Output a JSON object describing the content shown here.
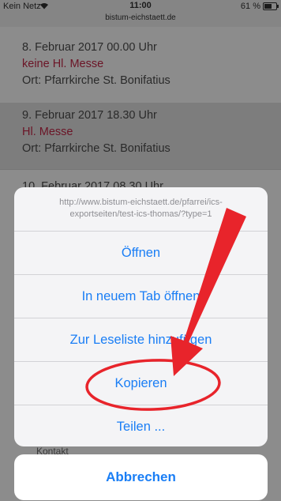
{
  "status_bar": {
    "carrier": "Kein Netz",
    "time": "11:00",
    "url": "bistum-eichstaett.de",
    "battery": "61 %"
  },
  "events": [
    {
      "date": "8. Februar 2017 00.00 Uhr",
      "title": "keine Hl. Messe",
      "location": "Ort: Pfarrkirche St. Bonifatius"
    },
    {
      "date": "9. Februar 2017 18.30 Uhr",
      "title": "Hl. Messe",
      "location": "Ort: Pfarrkirche St. Bonifatius"
    },
    {
      "date": "10. Februar 2017 08.30 Uhr"
    }
  ],
  "footer": {
    "kontakt": "Kontakt"
  },
  "action_sheet": {
    "url_line1": "http://www.bistum-eichstaett.de/pfarrei/ics-",
    "url_line2": "exportseiten/test-ics-thomas/?type=1",
    "actions": [
      "Öffnen",
      "In neuem Tab öffnen",
      "Zur Leseliste hinzufügen",
      "Kopieren",
      "Teilen ..."
    ],
    "cancel": "Abbrechen"
  },
  "colors": {
    "action_blue": "#1a7ef5",
    "annotation_red": "#e8242b",
    "event_title": "#6b1426"
  }
}
